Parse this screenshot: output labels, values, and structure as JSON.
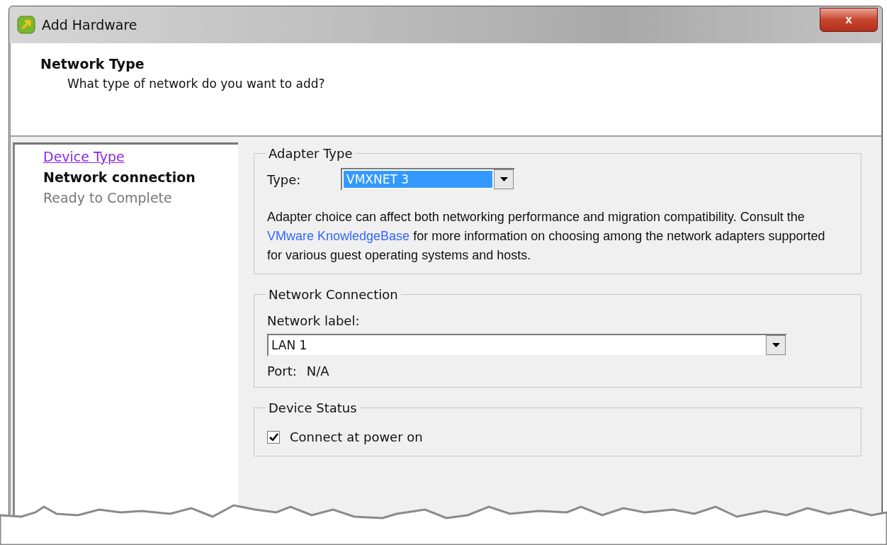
{
  "window": {
    "title": "Add Hardware",
    "close_label": "x"
  },
  "header": {
    "title": "Network Type",
    "subtitle": "What type of network do you want to add?"
  },
  "steps": [
    {
      "label": "Device Type",
      "kind": "visited"
    },
    {
      "label": "Network connection",
      "kind": "current"
    },
    {
      "label": "Ready to Complete",
      "kind": "pending"
    }
  ],
  "adapter_type": {
    "legend": "Adapter Type",
    "type_label": "Type:",
    "type_value": "VMXNET 3",
    "info_before": "Adapter choice can affect both networking performance and migration compatibility. Consult the",
    "info_link": "VMware KnowledgeBase",
    "info_after": "for more information on choosing among the network adapters supported for various guest operating systems and hosts."
  },
  "network_connection": {
    "legend": "Network Connection",
    "label": "Network label:",
    "value": "LAN 1",
    "port_label": "Port:",
    "port_value": "N/A"
  },
  "device_status": {
    "legend": "Device Status",
    "checkbox": {
      "label": "Connect at power on",
      "checked": true
    }
  }
}
